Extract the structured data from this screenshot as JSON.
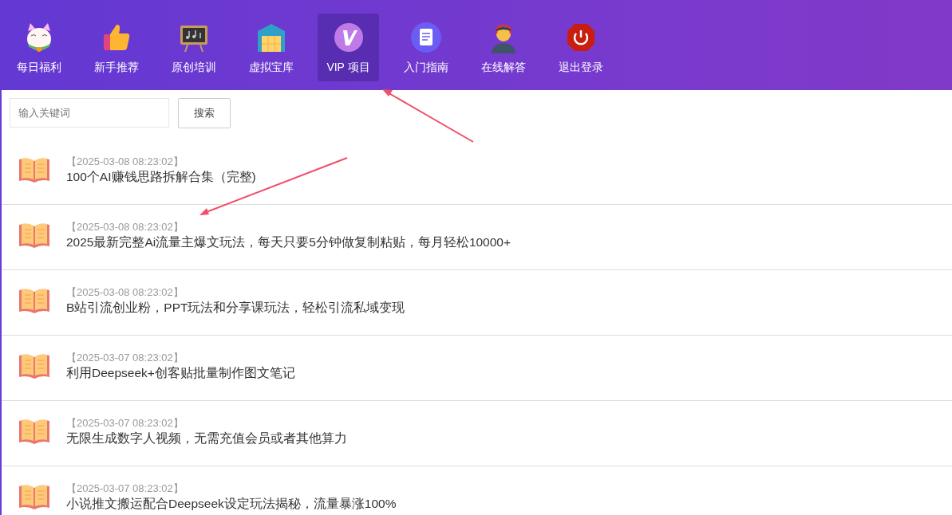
{
  "nav": [
    {
      "label": "每日福利",
      "selected": false
    },
    {
      "label": "新手推荐",
      "selected": false
    },
    {
      "label": "原创培训",
      "selected": false
    },
    {
      "label": "虚拟宝库",
      "selected": false
    },
    {
      "label": "VIP 项目",
      "selected": true
    },
    {
      "label": "入门指南",
      "selected": false
    },
    {
      "label": "在线解答",
      "selected": false
    },
    {
      "label": "退出登录",
      "selected": false
    }
  ],
  "search": {
    "placeholder": "输入关键词",
    "button": "搜索"
  },
  "articles": [
    {
      "date": "【2025-03-08 08:23:02】",
      "title": "100个AI赚钱思路拆解合集（完整)"
    },
    {
      "date": "【2025-03-08 08:23:02】",
      "title": "2025最新完整Ai流量主爆文玩法，每天只要5分钟做复制粘贴，每月轻松10000+"
    },
    {
      "date": "【2025-03-08 08:23:02】",
      "title": "B站引流创业粉，PPT玩法和分享课玩法，轻松引流私域变现"
    },
    {
      "date": "【2025-03-07 08:23:02】",
      "title": "利用Deepseek+创客贴批量制作图文笔记"
    },
    {
      "date": "【2025-03-07 08:23:02】",
      "title": "无限生成数字人视频，无需充值会员或者其他算力"
    },
    {
      "date": "【2025-03-07 08:23:02】",
      "title": "小说推文搬运配合Deepseek设定玩法揭秘，流量暴涨100%"
    }
  ]
}
